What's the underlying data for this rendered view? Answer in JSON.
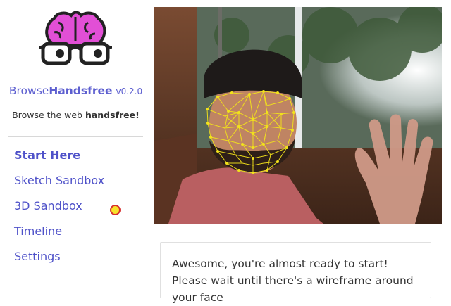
{
  "brand": {
    "name_prefix": "Browse",
    "name_bold": "Handsfree",
    "version": "v0.2.0",
    "tagline_prefix": "Browse the web ",
    "tagline_bold": "handsfree!"
  },
  "nav": {
    "items": [
      {
        "label": "Start Here",
        "active": true
      },
      {
        "label": "Sketch Sandbox",
        "active": false
      },
      {
        "label": "3D Sandbox",
        "active": false
      },
      {
        "label": "Timeline",
        "active": false
      },
      {
        "label": "Settings",
        "active": false
      }
    ]
  },
  "card": {
    "text": "Awesome, you're almost ready to start! Please wait until there's a wireframe around your face"
  },
  "colors": {
    "accent": "#4f52c9",
    "logo_brain": "#e24fd6",
    "wireframe": "#f2e21b",
    "pointer_fill": "#f7e22a",
    "pointer_border": "#d62d2d"
  }
}
